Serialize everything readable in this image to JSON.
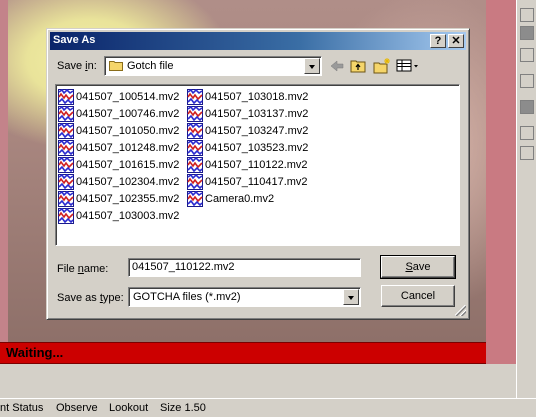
{
  "app": {
    "status_text": "Waiting...",
    "statusbar": [
      "nt Status",
      "Observe",
      "Lookout",
      "Size 1.50"
    ]
  },
  "dialog": {
    "title": "Save As",
    "help_label": "?",
    "close_label": "✕",
    "save_in_label_pre": "Save ",
    "save_in_label_mnemonic": "i",
    "save_in_label_post": "n:",
    "save_in_value": "Gotch file",
    "toolbar_icons": [
      "back-icon",
      "up-folder-icon",
      "new-folder-icon",
      "view-menu-icon"
    ],
    "files_col1": [
      "041507_100514.mv2",
      "041507_100746.mv2",
      "041507_101050.mv2",
      "041507_101248.mv2",
      "041507_101615.mv2",
      "041507_102304.mv2",
      "041507_102355.mv2",
      "041507_103003.mv2"
    ],
    "files_col2": [
      "041507_103018.mv2",
      "041507_103137.mv2",
      "041507_103247.mv2",
      "041507_103523.mv2",
      "041507_110122.mv2",
      "041507_110417.mv2",
      "Camera0.mv2"
    ],
    "file_name_label_pre": "File ",
    "file_name_label_mnemonic": "n",
    "file_name_label_post": "ame:",
    "file_name_value": "041507_110122.mv2",
    "save_type_label_pre": "Save as ",
    "save_type_label_mnemonic": "t",
    "save_type_label_post": "ype:",
    "save_type_value": "GOTCHA files (*.mv2)",
    "save_button_mnemonic": "S",
    "save_button_rest": "ave",
    "cancel_button": "Cancel"
  },
  "colors": {
    "title_gradient_start": "#0a246a",
    "status_red": "#cc0000",
    "dialog_face": "#d4d0c8"
  }
}
